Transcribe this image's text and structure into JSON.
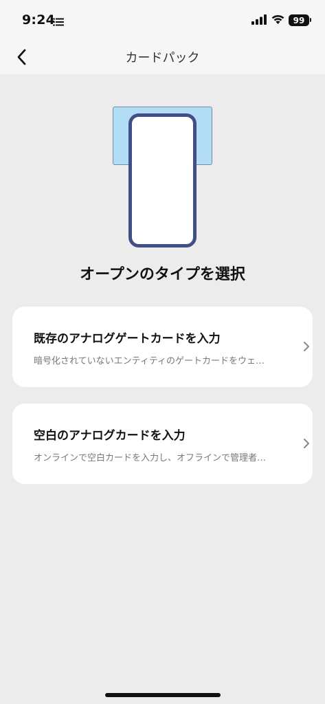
{
  "status_bar": {
    "time": "9:24",
    "battery": "99",
    "icons": [
      "list-icon",
      "signal-icon",
      "wifi-icon",
      "battery-icon"
    ]
  },
  "nav": {
    "title": "カードパック",
    "back_icon": "chevron-left-icon"
  },
  "main": {
    "heading": "オープンのタイプを選択",
    "options": [
      {
        "title": "既存のアナログゲートカードを入力",
        "description": "暗号化されていないエンティティのゲートカードをウェ…",
        "icon": "chevron-right-icon"
      },
      {
        "title": "空白のアナログカードを入力",
        "description": "オンラインで空白カードを入力し、オフラインで管理者…",
        "icon": "chevron-right-icon"
      }
    ]
  },
  "colors": {
    "background": "#ececec",
    "card_slot": "#b3dcf7",
    "phone_frame": "#414f86",
    "card": "#ffffff"
  }
}
